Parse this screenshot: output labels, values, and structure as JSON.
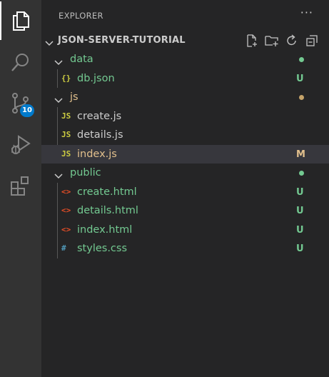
{
  "explorer": {
    "title": "EXPLORER",
    "more_label": "···",
    "project_name": "JSON-SERVER-TUTORIAL"
  },
  "activity_bar": {
    "items": [
      {
        "icon": "files-icon",
        "active": true
      },
      {
        "icon": "search-icon"
      },
      {
        "icon": "source-control-icon",
        "badge": "10"
      },
      {
        "icon": "run-debug-icon"
      },
      {
        "icon": "extensions-icon"
      }
    ]
  },
  "section_actions": [
    "new-file-icon",
    "new-folder-icon",
    "refresh-icon",
    "collapse-all-icon"
  ],
  "tree": [
    {
      "type": "folder",
      "label": "data",
      "depth": 0,
      "expanded": true,
      "status_dot": "#73c991",
      "label_color": "#73c991"
    },
    {
      "type": "file",
      "label": "db.json",
      "depth": 1,
      "icon": "{}",
      "icon_name": "json-file-icon",
      "icon_color": "#cbcb41",
      "status": "U",
      "status_color": "#73c991",
      "label_color": "#73c991"
    },
    {
      "type": "folder",
      "label": "js",
      "depth": 0,
      "expanded": true,
      "status_dot": "#c5a36a",
      "label_color": "#e2c08d"
    },
    {
      "type": "file",
      "label": "create.js",
      "depth": 1,
      "icon": "JS",
      "icon_name": "js-file-icon",
      "icon_color": "#cbcb41",
      "label_color": "#cccccc"
    },
    {
      "type": "file",
      "label": "details.js",
      "depth": 1,
      "icon": "JS",
      "icon_name": "js-file-icon",
      "icon_color": "#cbcb41",
      "label_color": "#cccccc"
    },
    {
      "type": "file",
      "label": "index.js",
      "depth": 1,
      "icon": "JS",
      "icon_name": "js-file-icon",
      "icon_color": "#cbcb41",
      "status": "M",
      "status_color": "#e2c08d",
      "label_color": "#e2c08d",
      "selected": true
    },
    {
      "type": "folder",
      "label": "public",
      "depth": 0,
      "expanded": true,
      "status_dot": "#73c991",
      "label_color": "#73c991"
    },
    {
      "type": "file",
      "label": "create.html",
      "depth": 1,
      "icon": "<>",
      "icon_name": "html-file-icon",
      "icon_color": "#e44d26",
      "status": "U",
      "status_color": "#73c991",
      "label_color": "#73c991"
    },
    {
      "type": "file",
      "label": "details.html",
      "depth": 1,
      "icon": "<>",
      "icon_name": "html-file-icon",
      "icon_color": "#e44d26",
      "status": "U",
      "status_color": "#73c991",
      "label_color": "#73c991"
    },
    {
      "type": "file",
      "label": "index.html",
      "depth": 1,
      "icon": "<>",
      "icon_name": "html-file-icon",
      "icon_color": "#e44d26",
      "status": "U",
      "status_color": "#73c991",
      "label_color": "#73c991"
    },
    {
      "type": "file",
      "label": "styles.css",
      "depth": 1,
      "icon": "#",
      "icon_name": "css-file-icon",
      "icon_color": "#519aba",
      "status": "U",
      "status_color": "#73c991",
      "label_color": "#73c991"
    }
  ]
}
